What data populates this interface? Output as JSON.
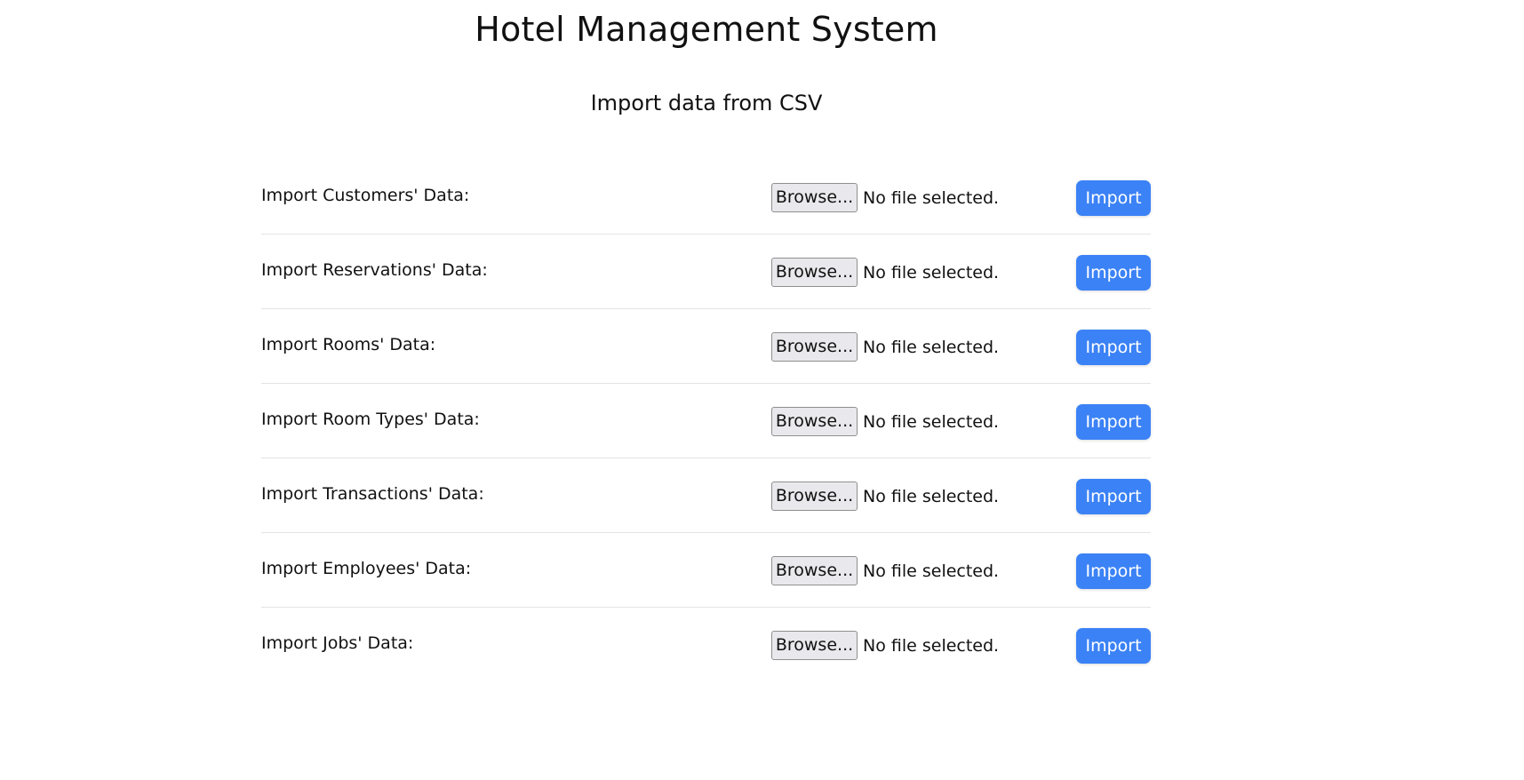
{
  "page": {
    "title": "Hotel Management System",
    "subtitle": "Import data from CSV"
  },
  "imports": [
    {
      "label": "Import Customers' Data:",
      "browse_label": "Browse...",
      "file_status": "No file selected.",
      "import_label": "Import"
    },
    {
      "label": "Import Reservations' Data:",
      "browse_label": "Browse...",
      "file_status": "No file selected.",
      "import_label": "Import"
    },
    {
      "label": "Import Rooms' Data:",
      "browse_label": "Browse...",
      "file_status": "No file selected.",
      "import_label": "Import"
    },
    {
      "label": "Import Room Types' Data:",
      "browse_label": "Browse...",
      "file_status": "No file selected.",
      "import_label": "Import"
    },
    {
      "label": "Import Transactions' Data:",
      "browse_label": "Browse...",
      "file_status": "No file selected.",
      "import_label": "Import"
    },
    {
      "label": "Import Employees' Data:",
      "browse_label": "Browse...",
      "file_status": "No file selected.",
      "import_label": "Import"
    },
    {
      "label": "Import Jobs' Data:",
      "browse_label": "Browse...",
      "file_status": "No file selected.",
      "import_label": "Import"
    }
  ],
  "colors": {
    "accent": "#3b82f6",
    "divider": "#e4e4e4",
    "browse_bg": "#e9e9ed"
  }
}
